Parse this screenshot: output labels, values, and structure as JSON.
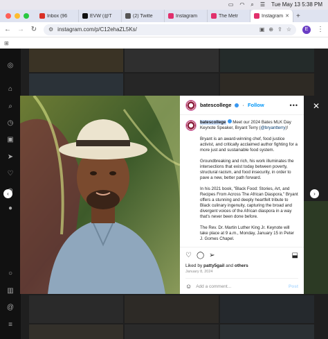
{
  "menubar": {
    "datetime": "Tue May 13  5:38 PM"
  },
  "tabs": [
    {
      "label": "Inbox (96",
      "favicon_color": "#d93025"
    },
    {
      "label": "EVW (@T",
      "favicon_color": "#111111"
    },
    {
      "label": "(2) Twitte",
      "favicon_color": "#555555"
    },
    {
      "label": "Instagram",
      "favicon_color": "#e1306c"
    },
    {
      "label": "The Metr",
      "favicon_color": "#e1306c"
    },
    {
      "label": "Instagram",
      "favicon_color": "#e1306c",
      "active": true
    }
  ],
  "address_bar": {
    "url": "instagram.com/p/C12ehaZL5Ks/",
    "profile_initial": "E"
  },
  "post": {
    "username": "batescollege",
    "follow_label": "Follow",
    "caption_lead": " Meet our 2024 Bates MLK Day Keynote Speaker, Bryant Terry (",
    "mention": "@bryantterry",
    "caption_lead_end": ")!",
    "paragraphs": [
      "Bryant is an award-winning chef, food justice activist, and critically acclaimed author fighting for a more just and sustainable food system.",
      "Groundbreaking and rich, his work illuminates the intersections that exist today between poverty, structural racism, and food insecurity, in order to pave a new, better path forward.",
      "In his 2021 book, \"Black Food: Stories, Art, and Recipes From Across The African Diaspora,\" Bryant offers a stunning and deeply heartfelt tribute to Black culinary ingenuity, capturing the broad and divergent voices of the African diaspora in a way that's never been done before.",
      "The Rev. Dr. Martin Luther King Jr. Keynote will take place at 9 a.m., Monday, January 15 in Peter J. Gomes Chapel."
    ],
    "liked_by_prefix": "Liked by ",
    "liked_by_user": "patty5gail",
    "liked_by_suffix": " and ",
    "liked_by_others": "others",
    "date": "January 8, 2024",
    "comment_placeholder": "Add a comment...",
    "post_label": "Post"
  },
  "colors": {
    "brand_maroon": "#8a1c3b",
    "follow_blue": "#0095f6"
  }
}
